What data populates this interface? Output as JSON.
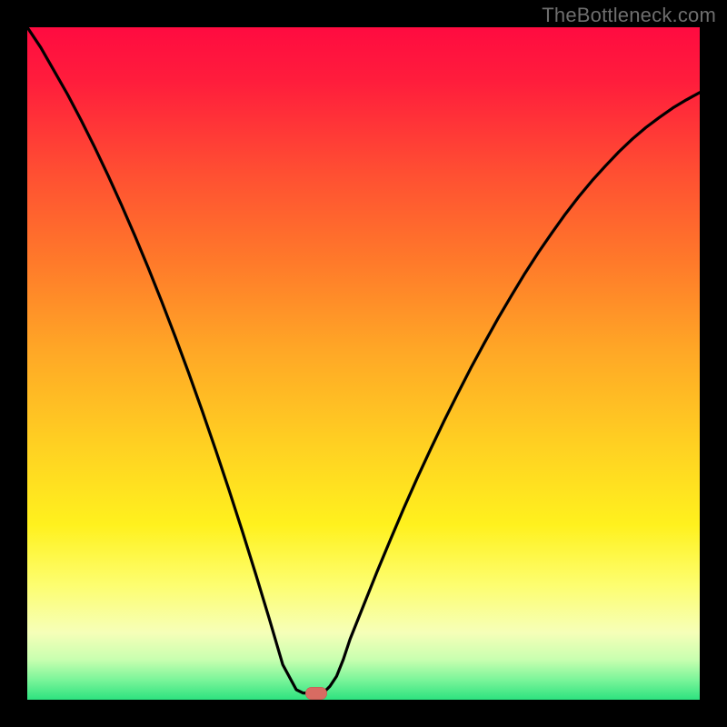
{
  "watermark": "TheBottleneck.com",
  "colors": {
    "frame_bg": "#000000",
    "watermark_text": "#6e6e6e",
    "curve": "#000000",
    "marker": "#d86b62",
    "gradient_stops": [
      "#ff0b40",
      "#ff1d3c",
      "#ff5032",
      "#ff7a2a",
      "#ffa726",
      "#ffd022",
      "#fff11e",
      "#fdfe70",
      "#f6ffb8",
      "#c9ffb0",
      "#7cf59a",
      "#2de27f"
    ]
  },
  "chart_data": {
    "type": "line",
    "title": "",
    "xlabel": "",
    "ylabel": "",
    "xlim": [
      0,
      100
    ],
    "ylim": [
      0,
      100
    ],
    "x": [
      0,
      2,
      4,
      6,
      8,
      10,
      12,
      14,
      16,
      18,
      20,
      22,
      24,
      26,
      28,
      30,
      32,
      34,
      36,
      38,
      40,
      41,
      42,
      43,
      44,
      45,
      46,
      47,
      48,
      50,
      52,
      54,
      56,
      58,
      60,
      62,
      64,
      66,
      68,
      70,
      72,
      74,
      76,
      78,
      80,
      82,
      84,
      86,
      88,
      90,
      92,
      94,
      96,
      98,
      100
    ],
    "values": [
      100,
      97,
      93.5,
      90,
      86.2,
      82.2,
      78,
      73.6,
      69,
      64.2,
      59.2,
      54,
      48.6,
      43,
      37.2,
      31.2,
      25,
      18.6,
      12,
      5.2,
      1.5,
      1,
      1,
      1,
      1,
      2,
      3.5,
      6,
      9,
      14,
      19,
      23.8,
      28.5,
      33,
      37.3,
      41.5,
      45.5,
      49.4,
      53.1,
      56.7,
      60.1,
      63.4,
      66.5,
      69.4,
      72.2,
      74.8,
      77.2,
      79.4,
      81.5,
      83.4,
      85.1,
      86.6,
      88,
      89.2,
      90.3
    ],
    "min_marker": {
      "x": 43,
      "y": 1
    },
    "notes": "x and y in percent of plot width/height; y=100 is top, y=0 is bottom; curve drops from top-left to a flat minimum near x≈41–45 then rises toward the right edge"
  }
}
